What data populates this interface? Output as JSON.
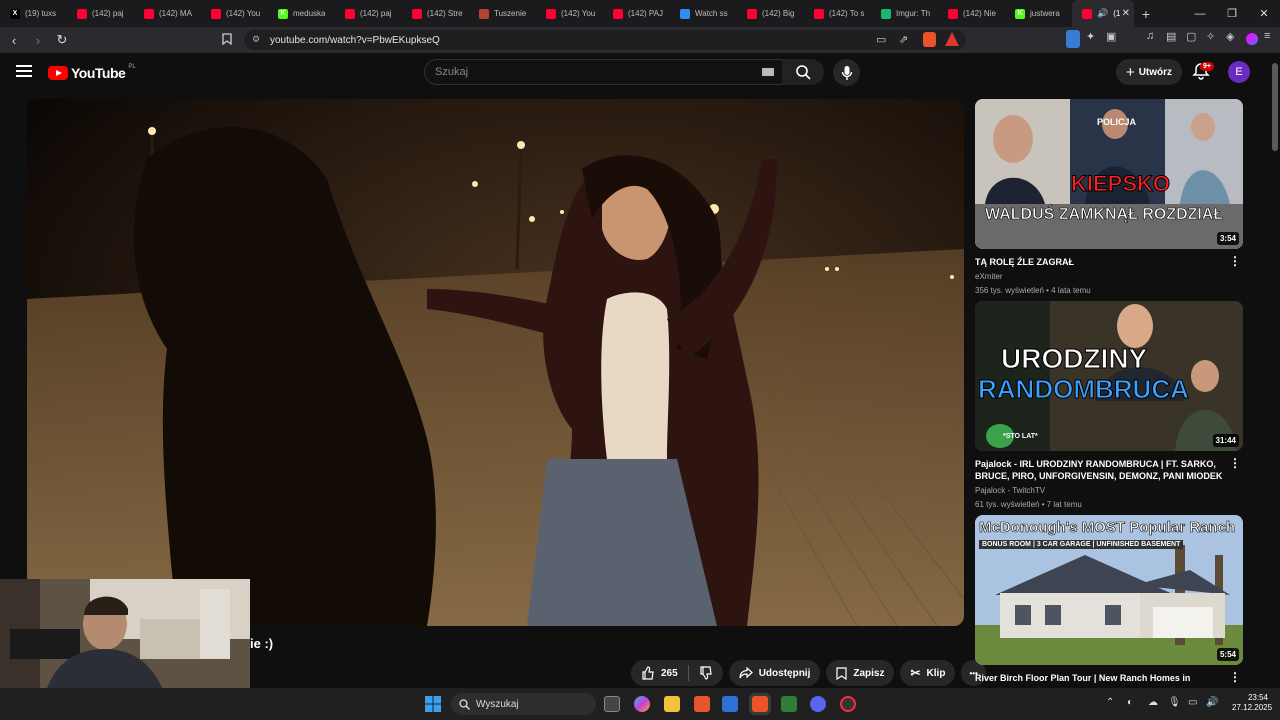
{
  "browser": {
    "tabs": [
      {
        "label": "(19) tuxs",
        "fav": "X",
        "color": "#000000"
      },
      {
        "label": "(142) paj",
        "fav": "",
        "color": "#ff0033"
      },
      {
        "label": "(142) MA",
        "fav": "",
        "color": "#ff0033"
      },
      {
        "label": "(142) You",
        "fav": "",
        "color": "#ff0033"
      },
      {
        "label": "meduska",
        "fav": "K",
        "color": "#53fc18"
      },
      {
        "label": "(142) paj",
        "fav": "",
        "color": "#ff0033"
      },
      {
        "label": "(142) Stre",
        "fav": "",
        "color": "#ff0033"
      },
      {
        "label": "Tuszenie",
        "fav": "",
        "color": "#b5452e"
      },
      {
        "label": "(142) You",
        "fav": "",
        "color": "#ff0033"
      },
      {
        "label": "(142) PAJ",
        "fav": "",
        "color": "#ff0033"
      },
      {
        "label": "Watch ss",
        "fav": "",
        "color": "#2e8ff0"
      },
      {
        "label": "(142) Big",
        "fav": "",
        "color": "#ff0033"
      },
      {
        "label": "(142) To s",
        "fav": "",
        "color": "#ff0033"
      },
      {
        "label": "Imgur: Th",
        "fav": "",
        "color": "#1bb76e"
      },
      {
        "label": "(142) Nie",
        "fav": "",
        "color": "#ff0033"
      },
      {
        "label": "justwera",
        "fav": "K",
        "color": "#53fc18"
      }
    ],
    "active_tab": {
      "label": "(1",
      "close": "✕"
    },
    "new_tab": "+",
    "window_controls": {
      "minimize": "—",
      "maximize": "❐",
      "close": "✕"
    },
    "url": "youtube.com/watch?v=PbwEKupkseQ"
  },
  "youtube": {
    "logo_text": "YouTube",
    "country_code": "PL",
    "search_placeholder": "Szukaj",
    "create_label": "Utwórz",
    "notifications_badge": "9+",
    "avatar_letter": "E"
  },
  "video": {
    "caption_fragment": "ie :)",
    "like_count": "265",
    "share_label": "Udostępnij",
    "save_label": "Zapisz",
    "clip_label": "Klip",
    "more_label": "•••"
  },
  "sidebar": {
    "videos": [
      {
        "title": "TĄ ROLĘ ŹLE ZAGRAŁ",
        "channel": "eXmiter",
        "meta": "356 tys. wyświetleń • 4 lata temu",
        "duration": "3:54",
        "thumb_text_1": "KIEPSKO",
        "thumb_text_2": "WALDUŚ ZAMKNĄŁ ROZDZIAŁ",
        "thumb_text_3": "POLICJA"
      },
      {
        "title": "Pajalock - IRL URODZINY RANDOMBRUCA | FT. SARKO, BRUCE, PIRO, UNFORGIVENSIN, DEMONZ, PANI MIODEK",
        "channel": "Pajalock - TwitchTV",
        "meta": "61 tys. wyświetleń • 7 lat temu",
        "duration": "31:44",
        "thumb_text_1": "URODZINY",
        "thumb_text_2": "RANDOMBRUCA",
        "thumb_text_3": "*STO LAT*"
      },
      {
        "title": "River Birch Floor Plan Tour | New Ranch Homes in",
        "channel": "",
        "meta": "",
        "duration": "5:54",
        "thumb_text_1": "McDonough's MOST Popular Ranch",
        "thumb_text_2": "BONUS ROOM | 3 CAR GARAGE | UNFINISHED BASEMENT"
      }
    ]
  },
  "taskbar": {
    "search_label": "Wyszukaj",
    "time": "23:54",
    "date": "27.12.2025"
  }
}
